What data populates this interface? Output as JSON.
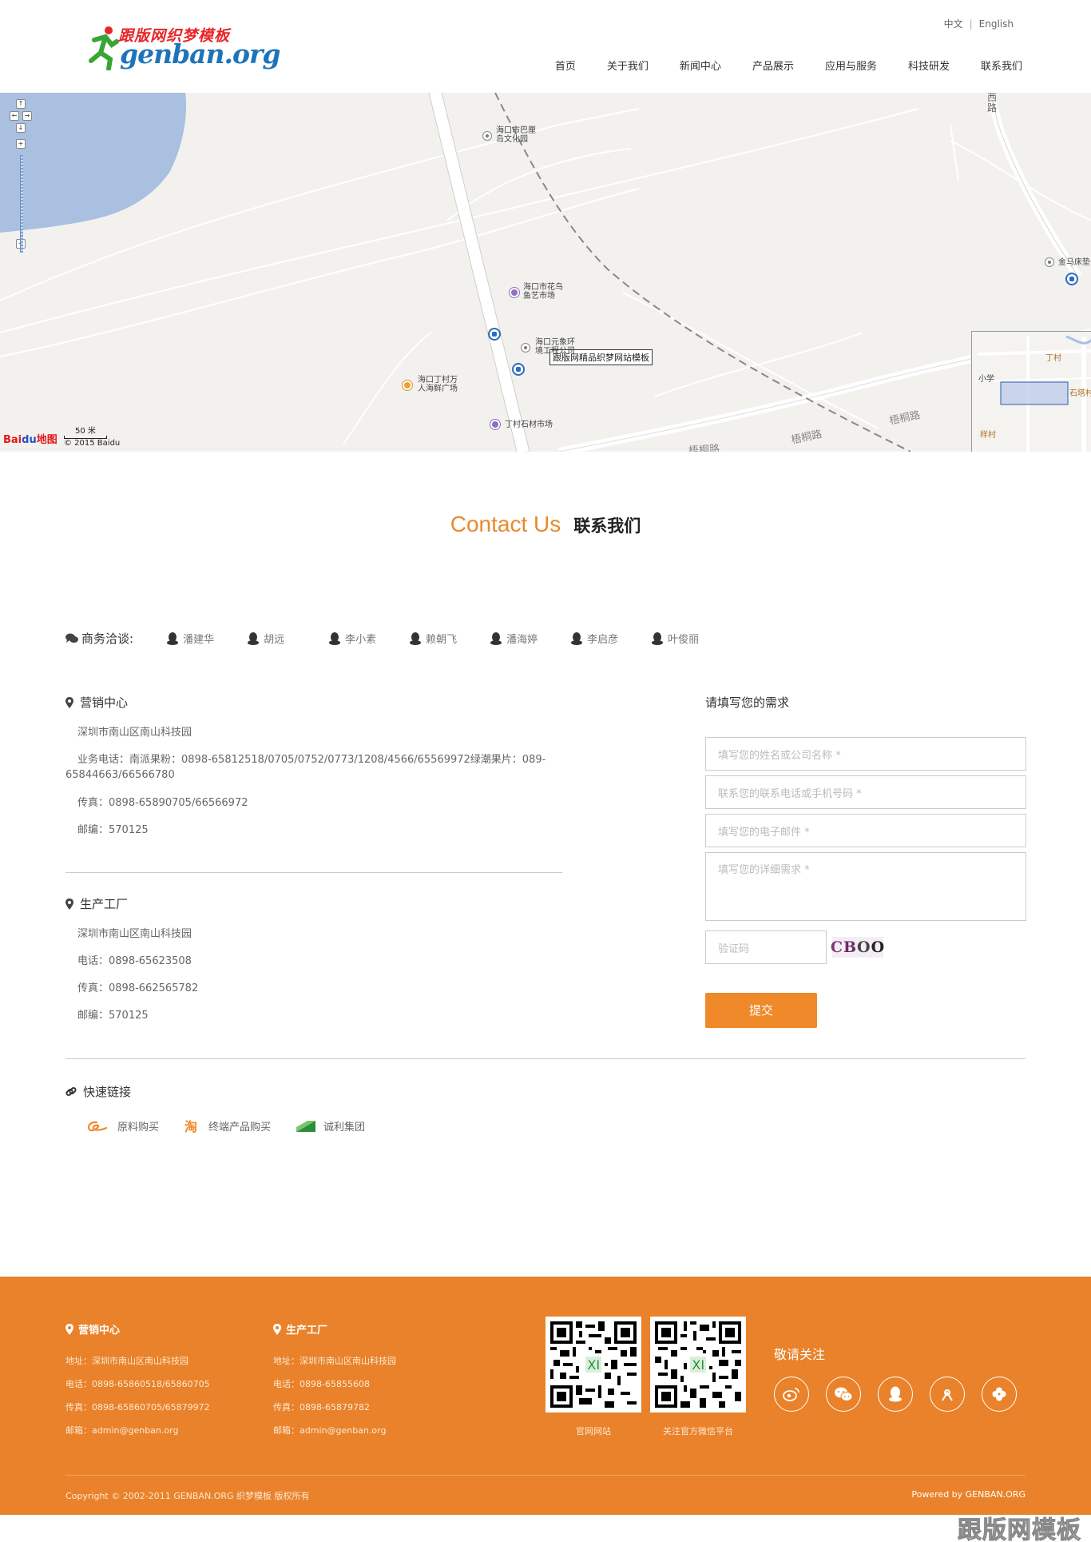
{
  "header": {
    "logo_cn": "跟版网织梦模板",
    "logo_en": "genban.org",
    "lang": {
      "zh": "中文",
      "sep": "|",
      "en": "English"
    },
    "nav": [
      "首页",
      "关于我们",
      "新闻中心",
      "产品展示",
      "应用与服务",
      "科技研发",
      "联系我们"
    ]
  },
  "map": {
    "marker": "跟版网精品织梦网站模板",
    "pois": {
      "bali": "海口市巴厘\n岛文化园",
      "huaniao": "海口市花鸟\n鱼艺市场",
      "yuanxiang": "海口元象环\n境工程公司",
      "haixian": "海口丁村万\n人海鲜广场",
      "shicai": "丁村石材市场",
      "jinma": "金马床垫"
    },
    "roads": {
      "wutong1": "梧桐路",
      "wutong2": "梧桐路",
      "wutong3": "梧桐路",
      "road_top": "西\n路"
    },
    "overview": {
      "dingcun": "丁村",
      "xiaoxue": "小学",
      "shita": "石塔村",
      "yangcun": "样村"
    },
    "scale": "50 米",
    "copyright": "© 2015 Baidu",
    "brand": {
      "bai": "Bai",
      "du": "du",
      "ditu": "地图"
    }
  },
  "contact": {
    "title_en": "Contact Us",
    "title_cn": "联系我们"
  },
  "biz": {
    "label": "商务洽谈:",
    "people": [
      "潘建华",
      "胡远",
      "李小素",
      "赖朝飞",
      "潘海婷",
      "李启彦",
      "叶俊丽"
    ]
  },
  "sales": {
    "title": "营销中心",
    "address": "深圳市南山区南山科技园",
    "phone": "业务电话：南派果粉：0898-65812518/0705/0752/0773/1208/4566/65569972绿潮果片：089-65844663/66566780",
    "fax": "传真：0898-65890705/66566972",
    "zip": "邮编：570125"
  },
  "factory": {
    "title": "生产工厂",
    "address": "深圳市南山区南山科技园",
    "phone": "电话：0898-65623508",
    "fax": "传真：0898-662565782",
    "zip": "邮编：570125"
  },
  "form": {
    "title": "请填写您的需求",
    "name_ph": "填写您的姓名或公司名称 *",
    "phone_ph": "联系您的联系电话或手机号码 *",
    "email_ph": "填写您的电子邮件 *",
    "detail_ph": "填写您的详细需求 *",
    "code_ph": "验证码",
    "captcha": [
      "C",
      "B",
      "O",
      "O"
    ],
    "submit": "提交"
  },
  "quick": {
    "title": "快速链接",
    "links": [
      "原料购买",
      "终端产品购买",
      "诚利集团"
    ]
  },
  "footer": {
    "sales": {
      "title": "营销中心",
      "address": "地址：深圳市南山区南山科技园",
      "phone": "电话：0898-65860518/65860705",
      "fax": "传真：0898-65860705/65879972",
      "email": "邮箱：admin@genban.org"
    },
    "factory": {
      "title": "生产工厂",
      "address": "地址：深圳市南山区南山科技园",
      "phone": "电话：0898-65855608",
      "fax": "传真：0898-65879782",
      "email": "邮箱：admin@genban.org"
    },
    "qr1_caption": "官网网站",
    "qr2_caption": "关注官方微信平台",
    "follow": "敬请关注",
    "social": [
      "weibo-icon",
      "wechat-icon",
      "qq-icon",
      "douban-icon",
      "clover-icon"
    ],
    "copyright": "Copyright © 2002-2011 GENBAN.ORG 织梦模板 版权所有",
    "powered": "Powered by GENBAN.ORG"
  },
  "watermark": "跟版网模板",
  "colors": {
    "accent": "#e88a2d",
    "footer_bg": "#e9822a",
    "submit": "#f0892a",
    "logo_red": "#e8262a",
    "logo_blue": "#1d74b9"
  }
}
